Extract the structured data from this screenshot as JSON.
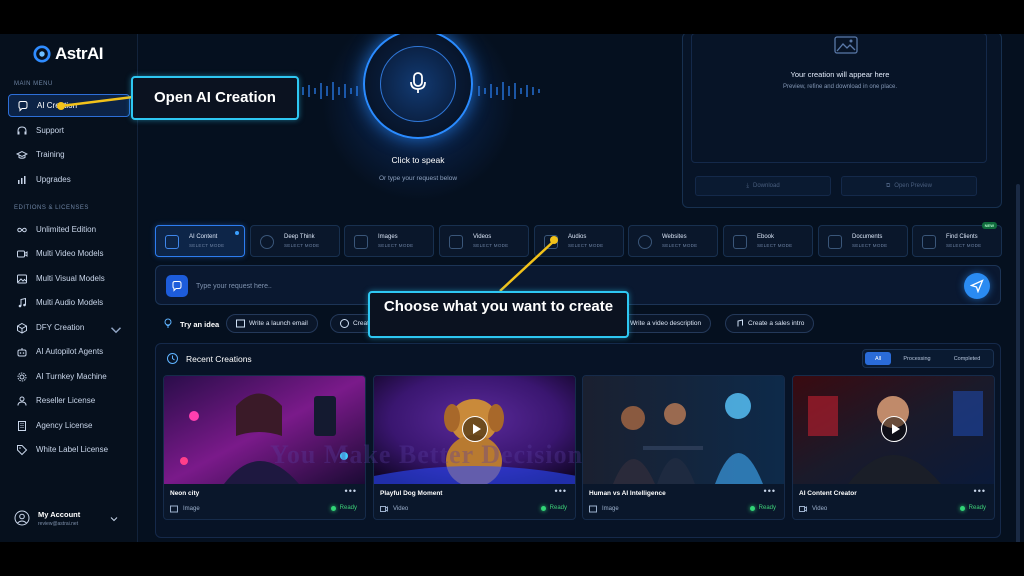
{
  "brand": {
    "name": "AstrAI"
  },
  "sidebar": {
    "main_menu_label": "MAIN MENU",
    "editions_label": "EDITIONS & LICENSES",
    "main_items": [
      {
        "label": "AI Creation",
        "icon": "chat-bubble-icon"
      },
      {
        "label": "Support",
        "icon": "headset-icon"
      },
      {
        "label": "Training",
        "icon": "graduation-cap-icon"
      },
      {
        "label": "Upgrades",
        "icon": "bar-chart-icon"
      }
    ],
    "edition_items": [
      {
        "label": "Unlimited Edition",
        "icon": "infinity-icon"
      },
      {
        "label": "Multi Video Models",
        "icon": "video-icon"
      },
      {
        "label": "Multi Visual Models",
        "icon": "image-icon"
      },
      {
        "label": "Multi Audio Models",
        "icon": "music-note-icon"
      },
      {
        "label": "DFY Creation",
        "icon": "cube-icon"
      },
      {
        "label": "AI Autopilot Agents",
        "icon": "robot-icon"
      },
      {
        "label": "AI Turnkey Machine",
        "icon": "gear-icon"
      },
      {
        "label": "Reseller License",
        "icon": "user-icon"
      },
      {
        "label": "Agency License",
        "icon": "building-icon"
      },
      {
        "label": "White Label License",
        "icon": "tag-icon"
      }
    ],
    "account": {
      "name": "My Account",
      "email": "review@astrai.net"
    }
  },
  "voice": {
    "title": "Click to speak",
    "subtitle": "Or type your request below"
  },
  "preview": {
    "title": "Your creation will appear here",
    "subtitle": "Preview, refine and download in one place.",
    "download_label": "Download",
    "open_preview_label": "Open Preview"
  },
  "modes": [
    {
      "label": "AI Content",
      "sub": "SELECT MODE",
      "active": true
    },
    {
      "label": "Deep Think",
      "sub": "SELECT MODE"
    },
    {
      "label": "Images",
      "sub": "SELECT MODE"
    },
    {
      "label": "Videos",
      "sub": "SELECT MODE"
    },
    {
      "label": "Audios",
      "sub": "SELECT MODE"
    },
    {
      "label": "Websites",
      "sub": "SELECT MODE"
    },
    {
      "label": "Ebook",
      "sub": "SELECT MODE"
    },
    {
      "label": "Documents",
      "sub": "SELECT MODE"
    },
    {
      "label": "Find Clients",
      "sub": "SELECT MODE",
      "badge": "NEW"
    }
  ],
  "prompt": {
    "placeholder": "Type your request here.."
  },
  "ideas": {
    "label": "Try an idea",
    "chips": [
      "Write a launch email",
      "Creat",
      "Write a video description",
      "Create a sales intro"
    ]
  },
  "recent": {
    "title": "Recent Creations",
    "filters": [
      "All",
      "Processing",
      "Completed"
    ],
    "cards": [
      {
        "title": "Neon city",
        "type": "Image",
        "status": "Ready",
        "menu": "•••"
      },
      {
        "title": "Playful Dog Moment",
        "type": "Video",
        "status": "Ready",
        "menu": "•••"
      },
      {
        "title": "Human vs AI Intelligence",
        "type": "Image",
        "status": "Ready",
        "menu": "•••"
      },
      {
        "title": "AI Content Creator",
        "type": "Video",
        "status": "Ready",
        "menu": "•••"
      }
    ]
  },
  "callouts": {
    "open_ai": "Open AI Creation",
    "choose": "Choose what you want to create"
  },
  "watermark": "You Make Better Decision",
  "colors": {
    "accent": "#2a8bf2",
    "callout_border": "#2ec7f2",
    "connector": "#f2c21a",
    "ready": "#3ed27a"
  }
}
